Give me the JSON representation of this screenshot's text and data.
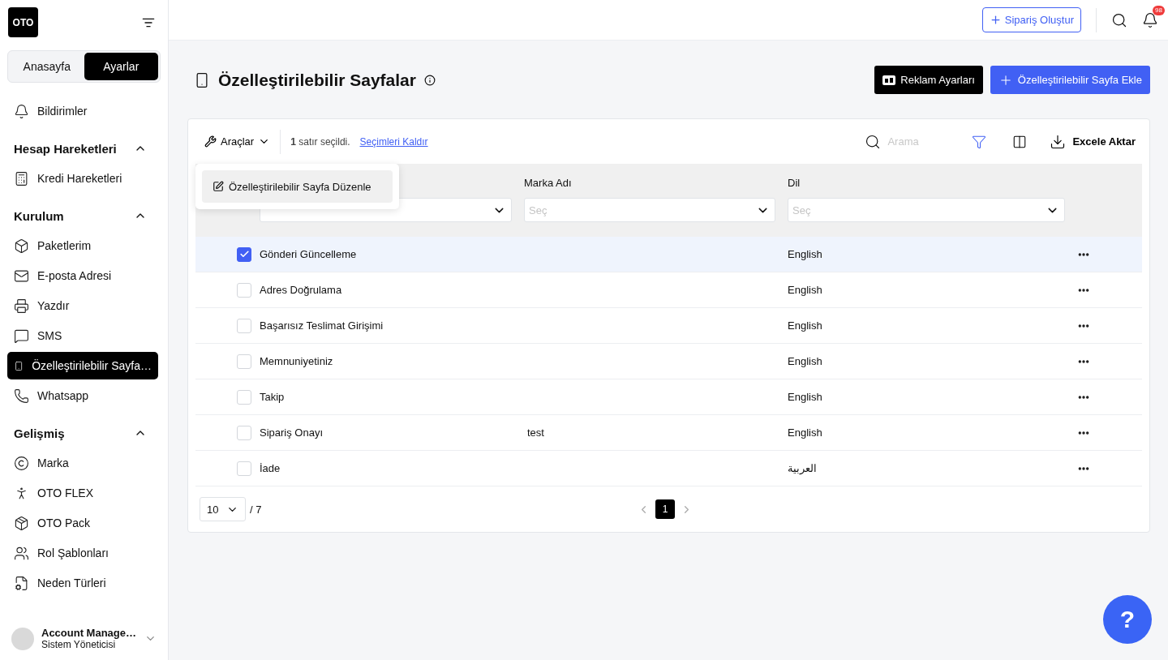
{
  "logo": "OTO",
  "sidebar": {
    "tabs": [
      {
        "label": "Anasayfa",
        "selected": false
      },
      {
        "label": "Ayarlar",
        "selected": true
      }
    ],
    "entries": [
      {
        "kind": "item",
        "label": "Bildirimler",
        "selected": false
      },
      {
        "kind": "group",
        "title": "Hesap Hareketleri",
        "expanded": true,
        "children": [
          {
            "label": "Kredi Hareketleri",
            "selected": false
          }
        ]
      },
      {
        "kind": "group",
        "title": "Kurulum",
        "expanded": true,
        "children": [
          {
            "label": "Paketlerim",
            "selected": false
          },
          {
            "label": "E-posta Adresi",
            "selected": false
          },
          {
            "label": "Yazdır",
            "selected": false
          },
          {
            "label": "SMS",
            "selected": false
          },
          {
            "label": "Özelleştirilebilir Sayfa…",
            "selected": true
          },
          {
            "label": "Whatsapp",
            "selected": false
          }
        ]
      },
      {
        "kind": "group",
        "title": "Gelişmiş",
        "expanded": true,
        "children": [
          {
            "label": "Marka",
            "selected": false
          },
          {
            "label": "OTO FLEX",
            "selected": false
          },
          {
            "label": "OTO Pack",
            "selected": false
          },
          {
            "label": "Rol Şablonları",
            "selected": false
          },
          {
            "label": "Neden Türleri",
            "selected": false
          }
        ]
      }
    ],
    "user": {
      "name": "Account Manage…",
      "role": "Sistem Yöneticisi"
    }
  },
  "topbar": {
    "create_button": "Sipariş Oluştur",
    "notification_count": "98"
  },
  "page": {
    "title": "Özelleştirilebilir Sayfalar",
    "buttons": [
      {
        "kind": "dark",
        "label": "Reklam Ayarları"
      },
      {
        "kind": "primary",
        "label": "Özelleştirilebilir Sayfa Ekle"
      }
    ]
  },
  "toolbar": {
    "tools_label": "Araçlar",
    "tools_expanded": true,
    "selection_text": "**1** satır seçildi.",
    "clear_link": "Seçimleri Kaldır",
    "search_placeholder": "Arama",
    "export_label": "Excele Aktar"
  },
  "tools_menu": [
    "Özelleştirilebilir Sayfa Düzenle"
  ],
  "table": {
    "columns": [
      {},
      {
        "label": "Marka Adı",
        "filter_placeholder": "Seç"
      },
      {
        "label": "Dil",
        "filter_placeholder": "Seç"
      }
    ],
    "rows": [
      {
        "checked": true,
        "cells": [
          "Gönderi Güncelleme",
          "",
          "English"
        ]
      },
      {
        "checked": false,
        "cells": [
          "Adres Doğrulama",
          "",
          "English"
        ]
      },
      {
        "checked": false,
        "cells": [
          "Başarısız Teslimat Girişimi",
          "",
          "English"
        ]
      },
      {
        "checked": false,
        "cells": [
          "Memnuniyetiniz",
          "",
          "English"
        ]
      },
      {
        "checked": false,
        "cells": [
          "Takip",
          "",
          "English"
        ]
      },
      {
        "checked": false,
        "cells": [
          "Sipariş Onayı",
          "test",
          "English"
        ]
      },
      {
        "checked": false,
        "cells": [
          "İade",
          "",
          "العربية"
        ]
      }
    ]
  },
  "pagination": {
    "page_size": "10",
    "total": "/ 7",
    "pages": [
      {
        "label": "1",
        "selected": true
      }
    ]
  },
  "help_button": "?"
}
